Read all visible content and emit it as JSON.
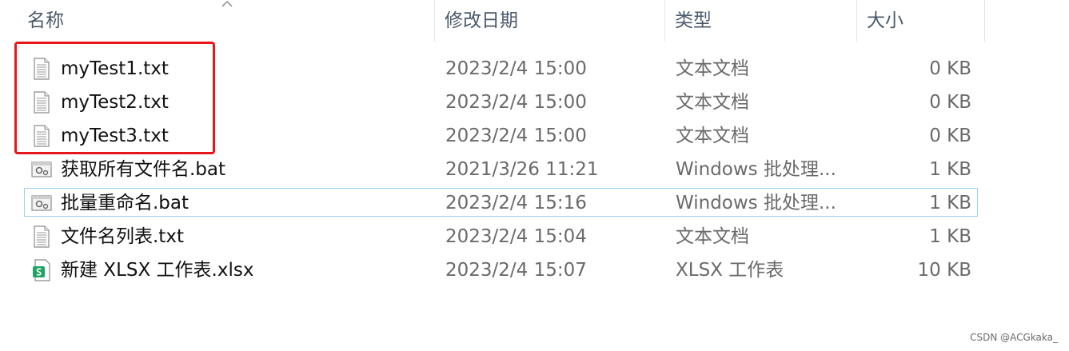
{
  "columns": {
    "name": "名称",
    "date": "修改日期",
    "type": "类型",
    "size": "大小"
  },
  "files": [
    {
      "name": "myTest1.txt",
      "date": "2023/2/4 15:00",
      "type": "文本文档",
      "size": "0 KB",
      "icon": "text-file-icon"
    },
    {
      "name": "myTest2.txt",
      "date": "2023/2/4 15:00",
      "type": "文本文档",
      "size": "0 KB",
      "icon": "text-file-icon"
    },
    {
      "name": "myTest3.txt",
      "date": "2023/2/4 15:00",
      "type": "文本文档",
      "size": "0 KB",
      "icon": "text-file-icon"
    },
    {
      "name": "获取所有文件名.bat",
      "date": "2021/3/26 11:21",
      "type": "Windows 批处理...",
      "size": "1 KB",
      "icon": "batch-file-icon"
    },
    {
      "name": "批量重命名.bat",
      "date": "2023/2/4 15:16",
      "type": "Windows 批处理...",
      "size": "1 KB",
      "icon": "batch-file-icon"
    },
    {
      "name": "文件名列表.txt",
      "date": "2023/2/4 15:04",
      "type": "文本文档",
      "size": "1 KB",
      "icon": "text-file-icon"
    },
    {
      "name": "新建 XLSX 工作表.xlsx",
      "date": "2023/2/4 15:07",
      "type": "XLSX 工作表",
      "size": "10 KB",
      "icon": "spreadsheet-file-icon"
    }
  ],
  "watermark": "CSDN @ACGkaka_",
  "colors": {
    "highlight_border": "#e8161b",
    "focus_border": "#9ad3f0",
    "spreadsheet_green": "#21a366"
  }
}
